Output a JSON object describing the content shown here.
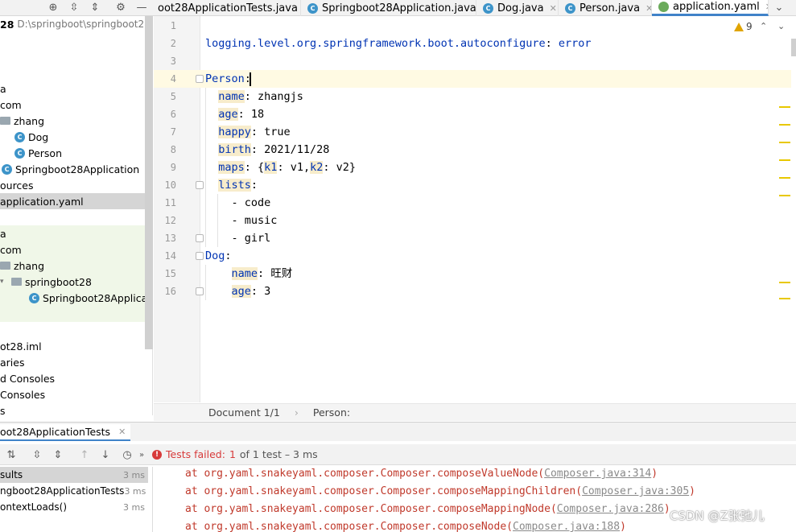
{
  "toolbar": {
    "icons": [
      "target-icon",
      "expand-all-icon",
      "collapse-all-icon",
      "gear-icon",
      "minimize-icon"
    ]
  },
  "editor_tabs": [
    {
      "label": "oot28ApplicationTests.java",
      "icon": "java-class-icon"
    },
    {
      "label": "Springboot28Application.java",
      "icon": "spring-class-icon"
    },
    {
      "label": "Dog.java",
      "icon": "java-class-icon"
    },
    {
      "label": "Person.java",
      "icon": "java-class-icon"
    },
    {
      "label": "application.yaml",
      "icon": "yaml-icon",
      "active": true
    }
  ],
  "project": {
    "root_name": "28",
    "root_path": "D:\\springboot\\springboot28",
    "tree": [
      {
        "label": "a"
      },
      {
        "label": "com"
      },
      {
        "label": "zhang",
        "type": "package"
      },
      {
        "label": "Dog",
        "type": "class"
      },
      {
        "label": "Person",
        "type": "class"
      },
      {
        "label": "Springboot28Application",
        "type": "spring-class"
      },
      {
        "label": "ources"
      },
      {
        "label": "application.yaml",
        "selected": true
      },
      {
        "label": "a"
      },
      {
        "label": "com"
      },
      {
        "label": "zhang",
        "type": "package"
      },
      {
        "label": "springboot28",
        "type": "package"
      },
      {
        "label": "Springboot28Applicatio",
        "type": "spring-class"
      },
      {
        "label": "ot28.iml"
      },
      {
        "label": "aries"
      },
      {
        "label": "d Consoles"
      },
      {
        "label": " Consoles"
      },
      {
        "label": "s"
      }
    ]
  },
  "inspection": {
    "warning_count": "9"
  },
  "code_lines": [
    {
      "no": "1",
      "key": "",
      "rest": ""
    },
    {
      "no": "2",
      "key": "logging.level.org.springframework.boot.autoconfigure",
      "rest": ": ",
      "val": "error"
    },
    {
      "no": "3",
      "key": "",
      "rest": ""
    },
    {
      "no": "4",
      "key": "Person",
      "rest": ":"
    },
    {
      "no": "5",
      "indent": "  ",
      "key": "name",
      "rest": ": zhangjs"
    },
    {
      "no": "6",
      "indent": "  ",
      "key": "age",
      "rest": ": 18"
    },
    {
      "no": "7",
      "indent": "  ",
      "key": "happy",
      "rest": ": true"
    },
    {
      "no": "8",
      "indent": "  ",
      "key": "birth",
      "rest": ": 2021/11/28"
    },
    {
      "no": "9",
      "indent": "  ",
      "key": "maps",
      "rest": ": {",
      "key2": "k1",
      "rest2": ": v1,",
      "key3": "k2",
      "rest3": ": v2}"
    },
    {
      "no": "10",
      "indent": "  ",
      "key": "lists",
      "rest": ":"
    },
    {
      "no": "11",
      "indent": "    ",
      "key": "",
      "rest": "- code"
    },
    {
      "no": "12",
      "indent": "    ",
      "key": "",
      "rest": "- music"
    },
    {
      "no": "13",
      "indent": "    ",
      "key": "",
      "rest": "- girl"
    },
    {
      "no": "14",
      "key": "Dog",
      "rest": ":"
    },
    {
      "no": "15",
      "indent": "    ",
      "key": "name",
      "rest": ": 旺财"
    },
    {
      "no": "16",
      "indent": "    ",
      "key": "age",
      "rest": ": 3"
    }
  ],
  "breadcrumb": {
    "document": "Document 1/1",
    "path": "Person:"
  },
  "run": {
    "tab_label": "oot28ApplicationTests",
    "status_failed": "Tests failed:",
    "status_count": "1",
    "status_rest": "of 1 test – 3 ms",
    "results": [
      {
        "label": "sults",
        "time": "3 ms",
        "selected": true
      },
      {
        "label": "ngboot28ApplicationTests",
        "time": "3 ms"
      },
      {
        "label": "ontextLoads()",
        "time": "3 ms"
      }
    ],
    "trace": [
      {
        "text": "at org.yaml.snakeyaml.composer.Composer.composeValueNode(",
        "link": "Composer.java:314",
        "end": ")"
      },
      {
        "text": "at org.yaml.snakeyaml.composer.Composer.composeMappingChildren(",
        "link": "Composer.java:305",
        "end": ")"
      },
      {
        "text": "at org.yaml.snakeyaml.composer.Composer.composeMappingNode(",
        "link": "Composer.java:286",
        "end": ")"
      },
      {
        "text": "at org.yaml.snakeyaml.composer.Composer.composeNode(",
        "link": "Composer.java:188",
        "end": ")"
      }
    ]
  },
  "watermark": "CSDN @Z张弛儿"
}
